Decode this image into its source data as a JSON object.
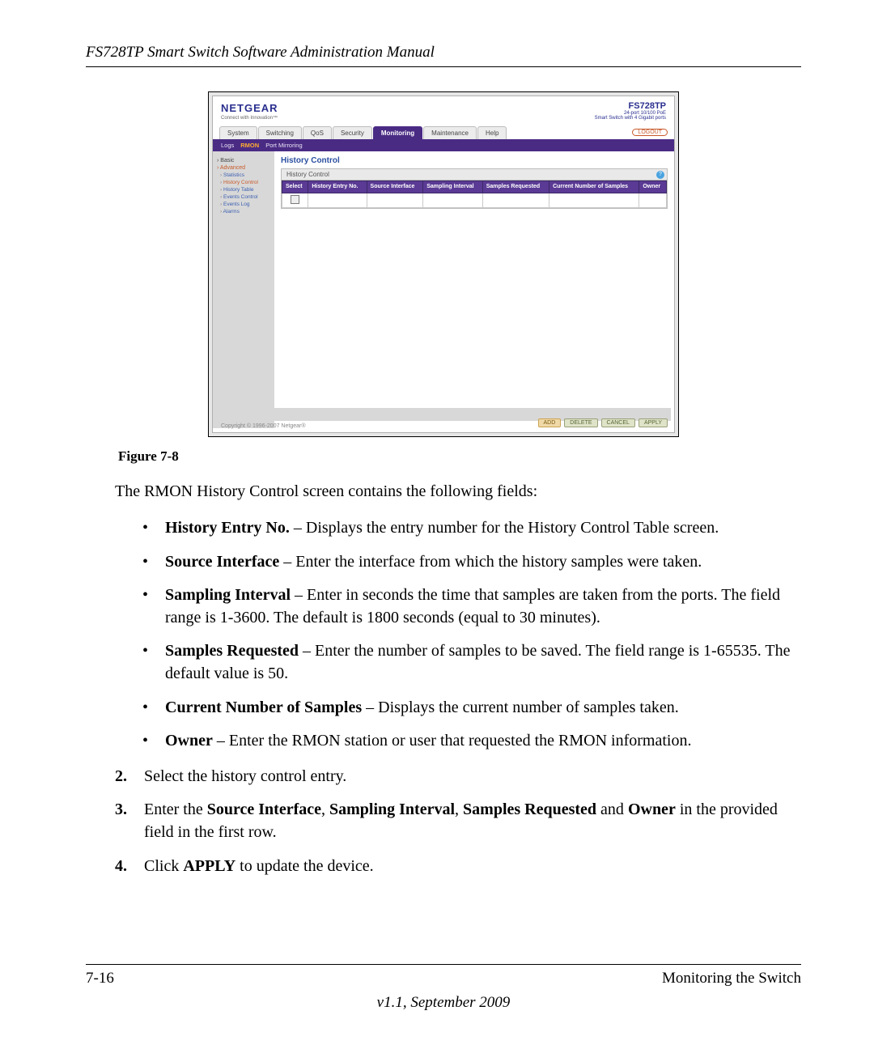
{
  "header": {
    "title": "FS728TP Smart Switch Software Administration Manual"
  },
  "screenshot": {
    "logo": "NETGEAR",
    "logo_sub": "Connect with Innovation™",
    "model": "FS728TP",
    "model_sub1": "24-port 10/100 PoE",
    "model_sub2": "Smart Switch with 4 Gigabit ports",
    "logout": "LOGOUT",
    "tabs": [
      "System",
      "Switching",
      "QoS",
      "Security",
      "Monitoring",
      "Maintenance",
      "Help"
    ],
    "active_tab": "Monitoring",
    "subtabs": [
      "Logs",
      "RMON",
      "Port Mirroring"
    ],
    "active_subtab": "RMON",
    "side": {
      "basic": "Basic",
      "advanced": "Advanced",
      "items": [
        "Statistics",
        "History Control",
        "History Table",
        "Events Control",
        "Events Log",
        "Alarms"
      ],
      "selected": "History Control"
    },
    "panel": {
      "title": "History Control",
      "head": "History Control",
      "cols": [
        "Select",
        "History Entry No.",
        "Source Interface",
        "Sampling Interval",
        "Samples Requested",
        "Current Number of Samples",
        "Owner"
      ]
    },
    "buttons": {
      "add": "ADD",
      "delete": "DELETE",
      "cancel": "CANCEL",
      "apply": "APPLY"
    },
    "copyright": "Copyright © 1996-2007 Netgear®"
  },
  "figure_caption": "Figure 7-8",
  "intro": "The RMON History Control screen contains the following fields:",
  "fields": [
    {
      "term": "History Entry No.",
      "desc": " – Displays the entry number for the History Control Table screen."
    },
    {
      "term": "Source Interface",
      "desc": " – Enter the interface from which the history samples were taken."
    },
    {
      "term": "Sampling Interval",
      "desc": " – Enter in seconds the time that samples are taken from the ports. The field range is 1-3600. The default is 1800 seconds (equal to 30 minutes)."
    },
    {
      "term": "Samples Requested",
      "desc": " – Enter the number of samples to be saved. The field range is 1-65535. The default value is 50."
    },
    {
      "term": "Current Number of Samples",
      "desc": " – Displays the current number of samples taken."
    },
    {
      "term": "Owner",
      "desc": " – Enter the RMON station or user that requested the RMON information."
    }
  ],
  "steps": {
    "s2": "Select the history control entry.",
    "s3_a": "Enter the ",
    "s3_b1": "Source Interface",
    "s3_c1": ", ",
    "s3_b2": "Sampling Interval",
    "s3_c2": ", ",
    "s3_b3": "Samples Requested",
    "s3_c3": " and ",
    "s3_b4": "Owner",
    "s3_d": " in the provided field in the first row.",
    "s4_a": "Click ",
    "s4_b": "APPLY",
    "s4_c": " to update the device."
  },
  "footer": {
    "left": "7-16",
    "right": "Monitoring the Switch",
    "version": "v1.1, September 2009"
  }
}
